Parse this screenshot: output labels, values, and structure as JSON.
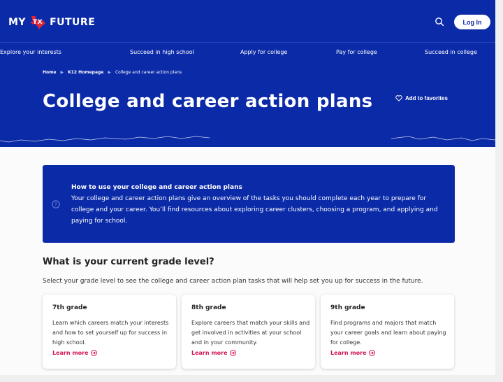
{
  "header": {
    "logo_left": "MY",
    "logo_badge": "TX",
    "logo_right": "FUTURE",
    "login_label": "Log In"
  },
  "nav": {
    "items": [
      {
        "label": "Explore your interests"
      },
      {
        "label": "Succeed in high school"
      },
      {
        "label": "Apply for college"
      },
      {
        "label": "Pay for college"
      },
      {
        "label": "Succeed in college"
      }
    ]
  },
  "breadcrumb": {
    "items": [
      {
        "label": "Home"
      },
      {
        "label": "K12 Homepage"
      },
      {
        "label": "College and career action plans"
      }
    ]
  },
  "hero": {
    "title": "College and career action plans",
    "favorite_label": "Add to favorites"
  },
  "info": {
    "title": "How to use your college and career action plans",
    "body": "Your college and career action plans give an overview of the tasks you should complete each year to prepare for college and your career. You’ll find resources about exploring career clusters, choosing a program, and applying and paying for school."
  },
  "grades": {
    "heading": "What is your current grade level?",
    "subtitle": "Select your grade level to see the college and career action plan tasks that will help set you up for success in the future.",
    "cards": [
      {
        "title": "7th grade",
        "desc": "Learn which careers match your interests and how to set yourself up for success in high school.",
        "link": "Learn more"
      },
      {
        "title": "8th grade",
        "desc": "Explore careers that match your skills and get involved in activities at your school and in your community.",
        "link": "Learn more"
      },
      {
        "title": "9th grade",
        "desc": "Find programs and majors that match your career goals and learn about paying for college.",
        "link": "Learn more"
      }
    ]
  },
  "colors": {
    "brand_blue": "#0b2aa8",
    "accent_red": "#d0124f",
    "texas_red": "#e2263a"
  }
}
